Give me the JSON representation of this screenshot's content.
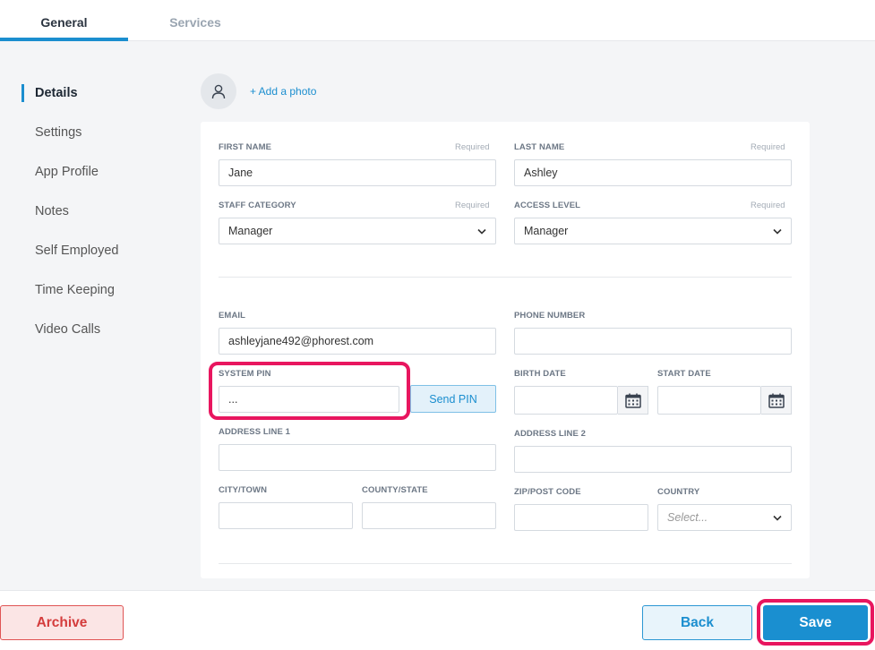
{
  "tabs": [
    {
      "label": "General",
      "active": true
    },
    {
      "label": "Services",
      "active": false
    }
  ],
  "sidebar": {
    "items": [
      {
        "label": "Details"
      },
      {
        "label": "Settings"
      },
      {
        "label": "App Profile"
      },
      {
        "label": "Notes"
      },
      {
        "label": "Self Employed"
      },
      {
        "label": "Time Keeping"
      },
      {
        "label": "Video Calls"
      }
    ]
  },
  "photo": {
    "add_label": "+ Add a photo",
    "icon": "user-icon"
  },
  "form": {
    "required_text": "Required",
    "first_name": {
      "label": "FIRST NAME",
      "value": "Jane"
    },
    "last_name": {
      "label": "LAST NAME",
      "value": "Ashley"
    },
    "staff_category": {
      "label": "STAFF CATEGORY",
      "value": "Manager"
    },
    "access_level": {
      "label": "ACCESS LEVEL",
      "value": "Manager"
    },
    "email": {
      "label": "EMAIL",
      "value": "ashleyjane492@phorest.com"
    },
    "phone": {
      "label": "PHONE NUMBER",
      "value": ""
    },
    "system_pin": {
      "label": "SYSTEM PIN",
      "value": "...",
      "send_label": "Send PIN"
    },
    "birth_date": {
      "label": "BIRTH DATE",
      "value": ""
    },
    "start_date": {
      "label": "START DATE",
      "value": ""
    },
    "address1": {
      "label": "ADDRESS LINE 1",
      "value": ""
    },
    "address2": {
      "label": "ADDRESS LINE 2",
      "value": ""
    },
    "city": {
      "label": "CITY/TOWN",
      "value": ""
    },
    "county": {
      "label": "COUNTY/STATE",
      "value": ""
    },
    "zip": {
      "label": "ZIP/POST CODE",
      "value": ""
    },
    "country": {
      "label": "COUNTRY",
      "placeholder": "Select..."
    }
  },
  "footer": {
    "archive_label": "Archive",
    "back_label": "Back",
    "save_label": "Save"
  },
  "colors": {
    "accent": "#1b8ecf",
    "highlight": "#e8165f",
    "danger": "#d43c3c"
  }
}
